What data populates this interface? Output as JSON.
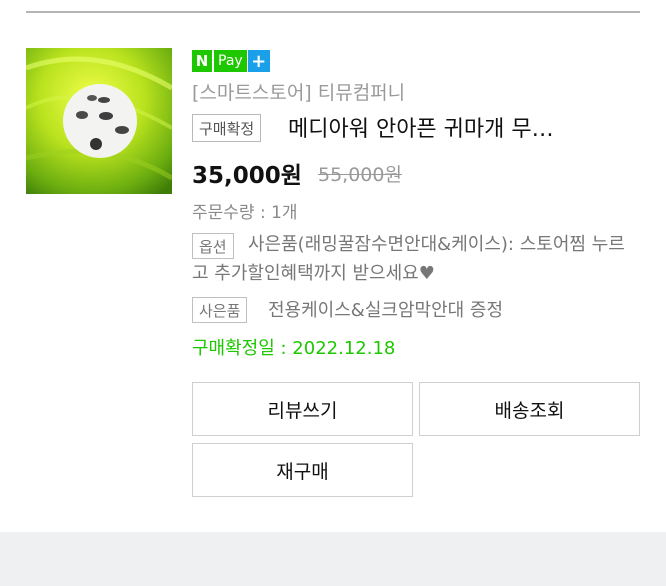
{
  "pay_badge": {
    "n_label": "N",
    "pay_label": "Pay",
    "plus_label": "+"
  },
  "order": {
    "store": "[스마트스토어] 티뮤컴퍼니",
    "status_tag": "구매확정",
    "product_name": "메디아워 안아픈 귀마개 무…",
    "price": "35,000원",
    "original_price": "55,000원",
    "quantity": "주문수량 : 1개",
    "option_tag": "옵션",
    "option_text": "사은품(래밍꿀잠수면안대&케이스): 스토어찜 누르고 추가할인혜택까지 받으세요♥",
    "gift_tag": "사은품",
    "gift_text": "전용케이스&실크암막안대 증정",
    "confirm_date": "구매확정일 : 2022.12.18"
  },
  "actions": {
    "review": "리뷰쓰기",
    "track": "배송조회",
    "rebuy": "재구매"
  },
  "colors": {
    "naver_green": "#1ec800",
    "pay_plus_blue": "#1aa0e8"
  }
}
